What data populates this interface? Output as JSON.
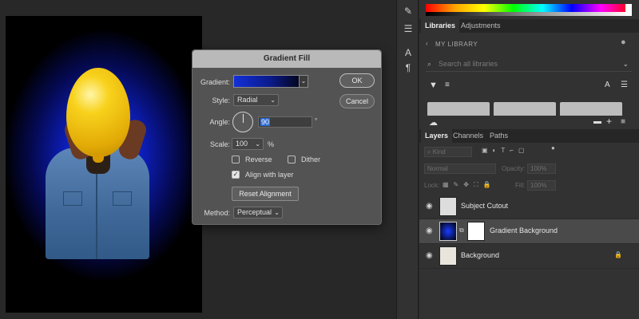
{
  "dialog": {
    "title": "Gradient Fill",
    "gradient_label": "Gradient:",
    "style_label": "Style:",
    "style_value": "Radial",
    "angle_label": "Angle:",
    "angle_value": "90",
    "angle_unit": "°",
    "scale_label": "Scale:",
    "scale_value": "100",
    "scale_unit": "%",
    "reverse_label": "Reverse",
    "reverse_checked": false,
    "dither_label": "Dither",
    "dither_checked": false,
    "align_label": "Align with layer",
    "align_checked": true,
    "reset_alignment": "Reset Alignment",
    "method_label": "Method:",
    "method_value": "Perceptual",
    "ok": "OK",
    "cancel": "Cancel"
  },
  "libraries": {
    "tabs": [
      "Libraries",
      "Adjustments"
    ],
    "library_name": "MY LIBRARY",
    "search_placeholder": "Search all libraries"
  },
  "layers_panel": {
    "tabs": [
      "Layers",
      "Channels",
      "Paths"
    ],
    "kind_placeholder": "Kind",
    "blend_mode": "Normal",
    "opacity_label": "Opacity:",
    "opacity_value": "100%",
    "lock_label": "Lock:",
    "fill_label": "Fill:",
    "fill_value": "100%",
    "layers": [
      {
        "name": "Subject Cutout",
        "selected": false
      },
      {
        "name": "Gradient Background",
        "selected": true
      },
      {
        "name": "Background",
        "selected": false,
        "locked": true
      }
    ]
  },
  "colors": {
    "gradient_start": "#1230d8",
    "gradient_end": "#000000",
    "dialog_bg": "#535353",
    "panel_bg": "#323232",
    "selection": "#2d6bd6"
  }
}
